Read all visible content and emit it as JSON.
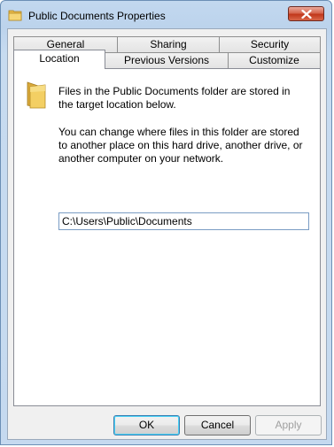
{
  "window": {
    "title": "Public Documents Properties"
  },
  "tabs": {
    "row1": [
      "General",
      "Sharing",
      "Security"
    ],
    "row2": [
      "Location",
      "Previous Versions",
      "Customize"
    ],
    "active": "Location"
  },
  "location": {
    "description": "Files in the Public Documents folder are stored in the target location below.",
    "help": "You can change where files in this folder are stored to another place on this hard drive, another drive, or another computer on your network.",
    "path": "C:\\Users\\Public\\Documents"
  },
  "buttons": {
    "ok": "OK",
    "cancel": "Cancel",
    "apply": "Apply"
  },
  "icons": {
    "title": "folder-icon",
    "close": "close-icon",
    "content": "folder-icon"
  }
}
